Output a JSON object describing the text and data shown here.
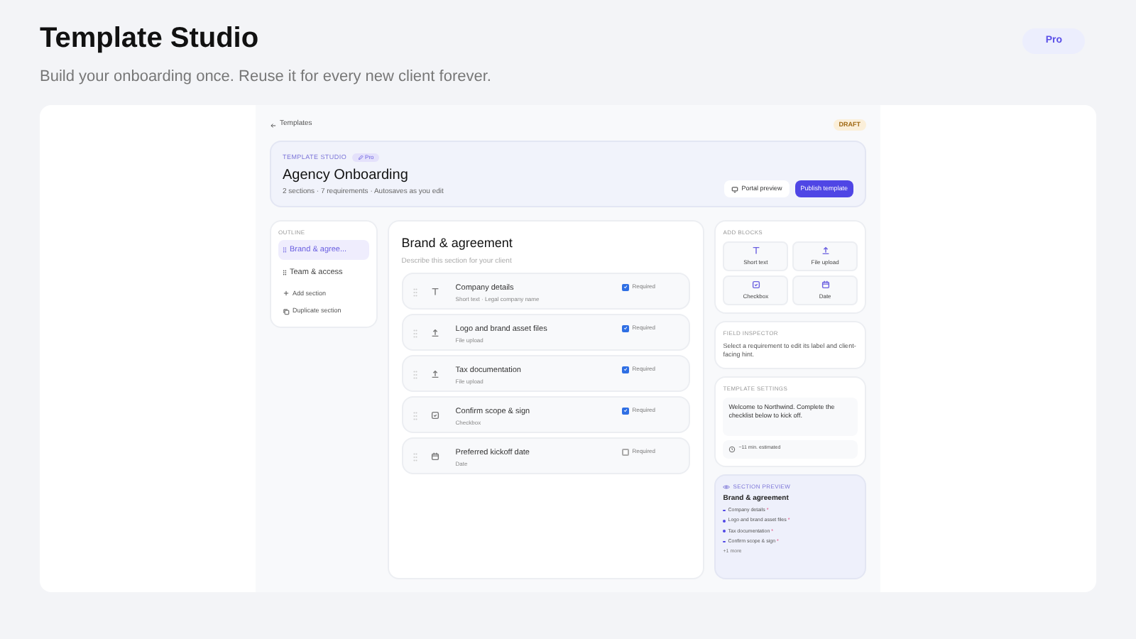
{
  "header": {
    "title": "Template Studio",
    "subtitle": "Build your onboarding once. Reuse it for every new client forever.",
    "badge": "Pro"
  },
  "app": {
    "back_link": "Templates",
    "status": "DRAFT",
    "hero": {
      "eyebrow": "TEMPLATE STUDIO",
      "tag": "Pro",
      "title": "Agency Onboarding",
      "meta": "2 sections · 7 requirements · Autosaves as you edit",
      "preview_button": "Portal preview",
      "publish_button": "Publish template"
    },
    "outline": {
      "title": "OUTLINE",
      "sections": [
        {
          "label": "Brand & agree...",
          "selected": true
        },
        {
          "label": "Team & access",
          "selected": false
        }
      ],
      "actions": [
        {
          "kind": "add",
          "label": "Add section"
        },
        {
          "kind": "duplicate",
          "label": "Duplicate section"
        }
      ]
    },
    "section": {
      "title": "Brand & agreement",
      "placeholder": "Describe this section for your client",
      "requirements": [
        {
          "kind": "text",
          "title": "Company details",
          "subtitle": "Short text · Legal company name",
          "required_label": "Required",
          "checked": true
        },
        {
          "kind": "upload",
          "title": "Logo and brand asset files",
          "subtitle": "File upload",
          "required_label": "Required",
          "checked": true
        },
        {
          "kind": "upload",
          "title": "Tax documentation",
          "subtitle": "File upload",
          "required_label": "Required",
          "checked": true
        },
        {
          "kind": "checkbox",
          "title": "Confirm scope & sign",
          "subtitle": "Checkbox",
          "required_label": "Required",
          "checked": true
        },
        {
          "kind": "date",
          "title": "Preferred kickoff date",
          "subtitle": "Date",
          "required_label": "Required",
          "checked": false
        }
      ]
    },
    "add_blocks": {
      "title": "ADD BLOCKS",
      "blocks": [
        {
          "kind": "text",
          "label": "Short text"
        },
        {
          "kind": "upload",
          "label": "File upload"
        },
        {
          "kind": "checkbox",
          "label": "Checkbox"
        },
        {
          "kind": "date",
          "label": "Date"
        }
      ]
    },
    "inspector": {
      "title": "FIELD INSPECTOR",
      "text": "Select a requirement to edit its label and client-facing hint."
    },
    "settings": {
      "title": "TEMPLATE SETTINGS",
      "welcome": "Welcome to Northwind. Complete the checklist below to kick off.",
      "estimate": "~11 min. estimated"
    },
    "preview": {
      "title": "SECTION PREVIEW",
      "section": "Brand & agreement",
      "items": [
        {
          "label": "Company details",
          "required": true
        },
        {
          "label": "Logo and brand asset files",
          "required": true
        },
        {
          "label": "Tax documentation",
          "required": true
        },
        {
          "label": "Confirm scope & sign",
          "required": true
        }
      ],
      "more": "+1 more",
      "star": "*"
    }
  }
}
